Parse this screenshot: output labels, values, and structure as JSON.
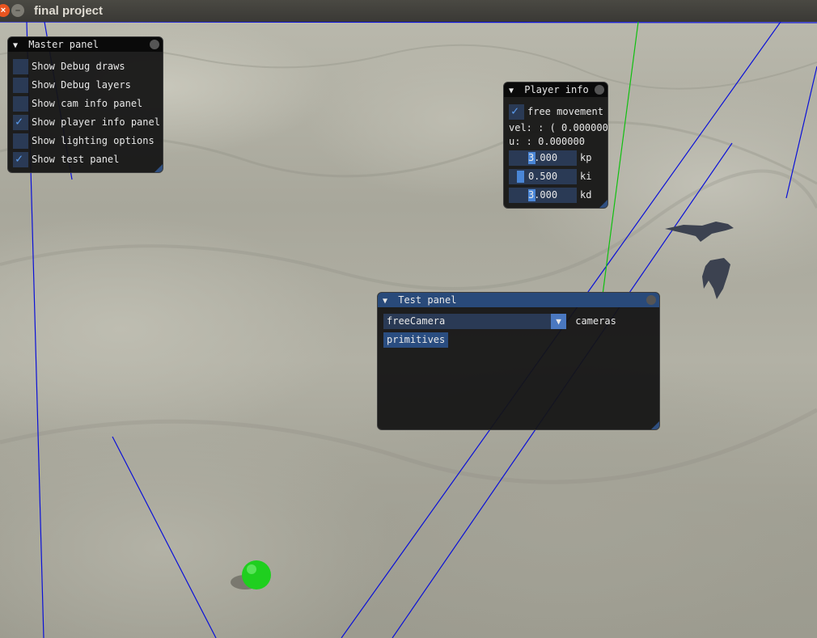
{
  "window": {
    "title": "final project"
  },
  "master_panel": {
    "title": "Master panel",
    "items": [
      {
        "label": "Show Debug draws",
        "checked": false
      },
      {
        "label": "Show Debug layers",
        "checked": false
      },
      {
        "label": "Show cam info panel",
        "checked": false
      },
      {
        "label": "Show player info panel",
        "checked": true
      },
      {
        "label": "Show lighting options",
        "checked": false
      },
      {
        "label": "Show test panel",
        "checked": true
      }
    ]
  },
  "player_panel": {
    "title": "Player info",
    "free_movement_label": "free movement",
    "free_movement_checked": true,
    "vel_text": "vel: : ( 0.000000",
    "u_text": "u: : 0.000000",
    "kp": {
      "value": "3.000",
      "label": "kp"
    },
    "ki": {
      "value": "0.500",
      "label": "ki"
    },
    "kd": {
      "value": "3.000",
      "label": "kd"
    }
  },
  "test_panel": {
    "title": "Test panel",
    "combo_value": "freeCamera",
    "combo_label": "cameras",
    "primitives_button": "primitives"
  },
  "icons": {
    "collapse": "triangle-down-icon",
    "check": "checkmark-icon",
    "close": "close-icon",
    "minimize": "minimize-icon"
  },
  "colors": {
    "panel_bg": "#141414",
    "active_title": "#294a7a",
    "frame_bg": "#2a3a55",
    "check": "#5b9bec",
    "debug_line_blue": "#0000ff",
    "debug_line_green": "#00c800",
    "sphere": "#22cc22"
  }
}
